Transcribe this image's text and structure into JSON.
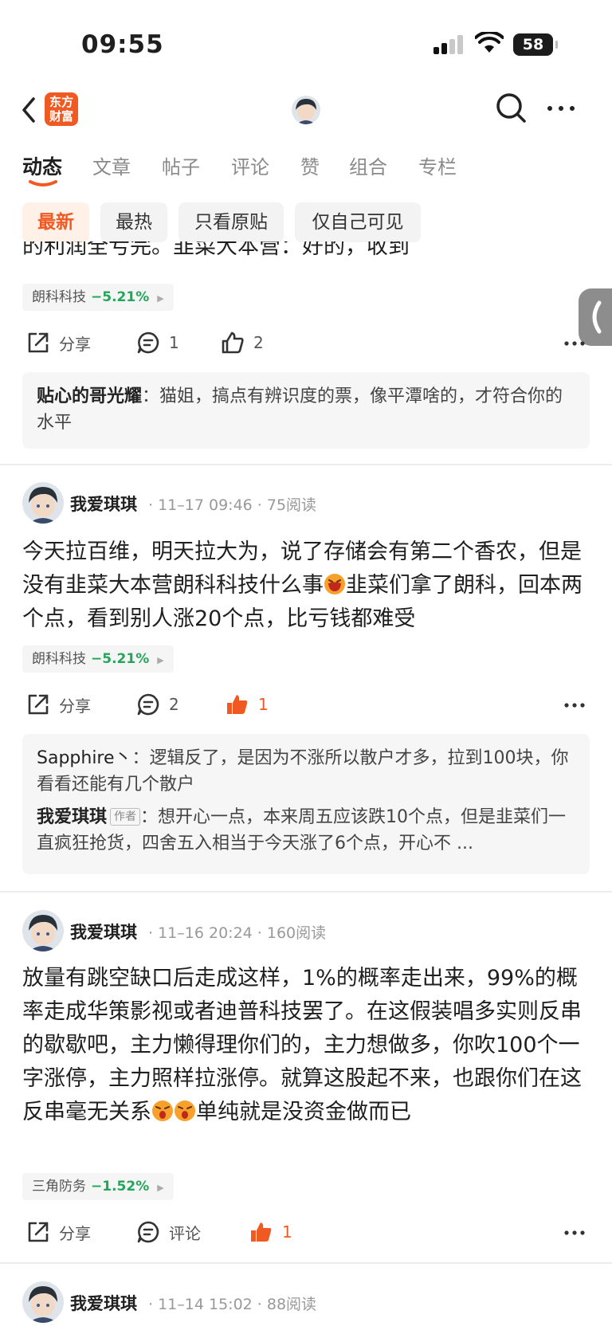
{
  "status_bar": {
    "time": "09:55",
    "battery": "58"
  },
  "nav": {
    "logo_text": "东方财富"
  },
  "tabs": [
    {
      "label": "动态",
      "active": true
    },
    {
      "label": "文章"
    },
    {
      "label": "帖子"
    },
    {
      "label": "评论"
    },
    {
      "label": "赞"
    },
    {
      "label": "组合"
    },
    {
      "label": "专栏"
    }
  ],
  "filters": [
    {
      "label": "最新",
      "active": true
    },
    {
      "label": "最热"
    },
    {
      "label": "只看原贴"
    },
    {
      "label": "仅自己可见"
    }
  ],
  "post0": {
    "clipped_text": "的利润全亏完。韭菜大本营：好的，收到",
    "stock": {
      "name": "朗科科技",
      "change": "−5.21%"
    },
    "share_label": "分享",
    "comment_count": "1",
    "like_count": "2",
    "comment": {
      "user": "贴心的哥光耀",
      "text": "猫姐，搞点有辨识度的票，像平潭啥的，才符合你的水平"
    }
  },
  "post1": {
    "user": "我爱琪琪",
    "time": "11–17 09:46",
    "reads": "75阅读",
    "body_a": "今天拉百维，明天拉大为，说了存储会有第二个香农，但是没有韭菜大本营朗科科技什么事",
    "body_b": "韭菜们拿了朗科，回本两个点，看到别人涨20个点，比亏钱都难受",
    "stock": {
      "name": "朗科科技",
      "change": "−5.21%"
    },
    "share_label": "分享",
    "comment_count": "2",
    "like_count": "1",
    "comments": [
      {
        "user": "Sapphire丶",
        "text": "逻辑反了，是因为不涨所以散户才多，拉到100块，你看看还能有几个散户"
      },
      {
        "user": "我爱琪琪",
        "tag": "作者",
        "text": "想开心一点，本来周五应该跌10个点，但是韭菜们一直疯狂抢货，四舍五入相当于今天涨了6个点，开心不 ..."
      }
    ]
  },
  "post2": {
    "user": "我爱琪琪",
    "time": "11–16 20:24",
    "reads": "160阅读",
    "body_a": "放量有跳空缺口后走成这样，1%的概率走出来，99%的概率走成华策影视或者迪普科技罢了。在这假装唱多实则反串的歇歇吧，主力懒得理你们的，主力想做多，你吹100个一字涨停，主力照样拉涨停。就算这股起不来，也跟你们在这反串毫无关系",
    "body_b": "单纯就是没资金做而已",
    "stock": {
      "name": "三角防务",
      "change": "−1.52%"
    },
    "share_label": "分享",
    "comment_label": "评论",
    "like_count": "1"
  },
  "post3": {
    "user": "我爱琪琪",
    "time": "11–14 15:02",
    "reads": "88阅读"
  },
  "colors": {
    "accent": "#f05a22",
    "down_green": "#25a55a"
  }
}
